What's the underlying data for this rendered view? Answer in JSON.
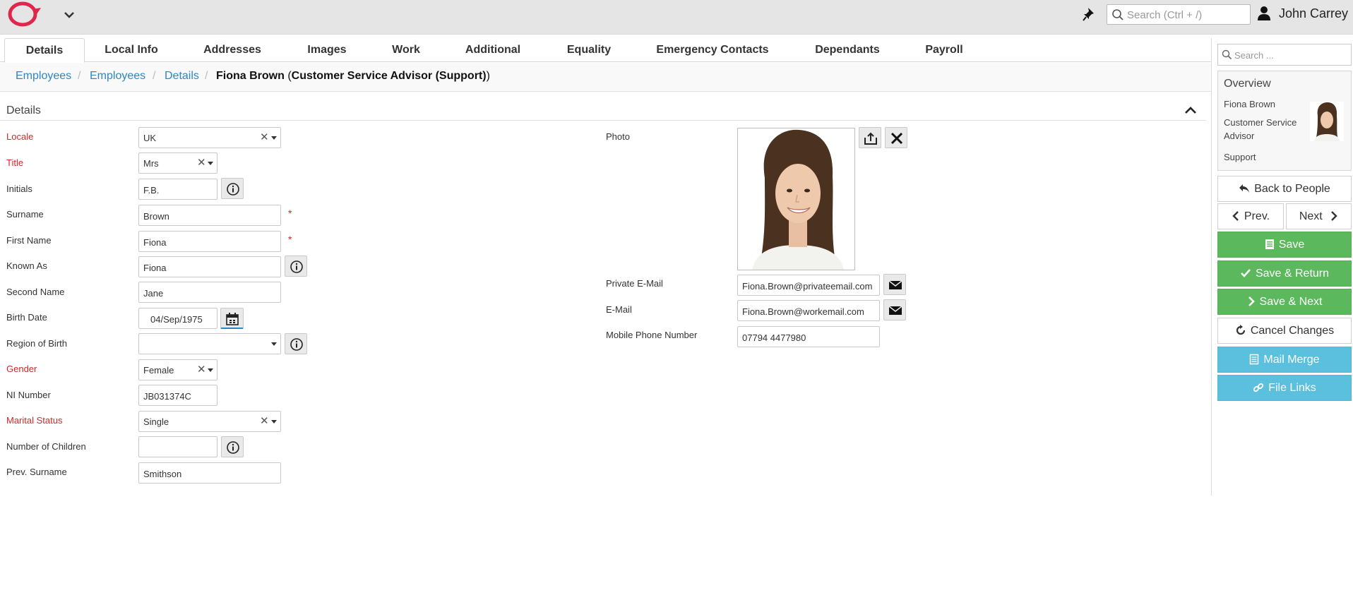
{
  "topbar": {
    "search_placeholder": "Search (Ctrl + /)",
    "user_name": "John Carrey"
  },
  "tabs": [
    {
      "label": "Details",
      "active": true
    },
    {
      "label": "Local Info"
    },
    {
      "label": "Addresses"
    },
    {
      "label": "Images"
    },
    {
      "label": "Work"
    },
    {
      "label": "Additional"
    },
    {
      "label": "Equality"
    },
    {
      "label": "Emergency Contacts"
    },
    {
      "label": "Dependants"
    },
    {
      "label": "Payroll"
    }
  ],
  "breadcrumb": {
    "items": [
      "Employees",
      "Employees",
      "Details"
    ],
    "separator": "/",
    "current_name": "Fiona Brown",
    "current_role": "Customer Service Advisor (Support)",
    "open_paren": "(",
    "close_paren": ")"
  },
  "section": {
    "title": "Details"
  },
  "form": {
    "locale": {
      "label": "Locale",
      "value": "UK"
    },
    "title": {
      "label": "Title",
      "value": "Mrs"
    },
    "initials": {
      "label": "Initials",
      "value": "F.B."
    },
    "surname": {
      "label": "Surname",
      "value": "Brown"
    },
    "first_name": {
      "label": "First Name",
      "value": "Fiona"
    },
    "known_as": {
      "label": "Known As",
      "value": "Fiona"
    },
    "second_name": {
      "label": "Second Name",
      "value": "Jane"
    },
    "birth_date": {
      "label": "Birth Date",
      "value": "04/Sep/1975"
    },
    "region_of_birth": {
      "label": "Region of Birth",
      "value": ""
    },
    "gender": {
      "label": "Gender",
      "value": "Female"
    },
    "ni_number": {
      "label": "NI Number",
      "value": "JB031374C"
    },
    "marital_status": {
      "label": "Marital Status",
      "value": "Single"
    },
    "number_of_children": {
      "label": "Number of Children",
      "value": ""
    },
    "prev_surname": {
      "label": "Prev. Surname",
      "value": "Smithson"
    },
    "required_marker": "*",
    "photo": {
      "label": "Photo"
    },
    "private_email": {
      "label": "Private E-Mail",
      "value": "Fiona.Brown@privateemail.com"
    },
    "email": {
      "label": "E-Mail",
      "value": "Fiona.Brown@workemail.com"
    },
    "mobile": {
      "label": "Mobile Phone Number",
      "value": "07794 4477980"
    }
  },
  "right_panel": {
    "search_placeholder": "Search ...",
    "overview": {
      "title": "Overview",
      "name": "Fiona Brown",
      "role": "Customer Service Advisor",
      "department": "Support"
    },
    "buttons": {
      "back": "Back to People",
      "prev": "Prev.",
      "next": "Next",
      "save": "Save",
      "save_return": "Save & Return",
      "save_next": "Save & Next",
      "cancel": "Cancel Changes",
      "mail_merge": "Mail Merge",
      "file_links": "File Links"
    }
  },
  "colors": {
    "accent_link": "#2f86c2",
    "required_label": "#cc2a2a",
    "save_green": "#5cb85c",
    "info_blue": "#5bc0de",
    "logo_red": "#e0264a"
  }
}
